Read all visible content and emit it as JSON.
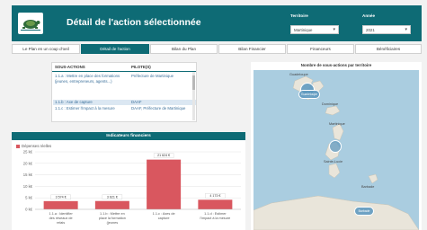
{
  "header": {
    "title": "Détail de l'action sélectionnée",
    "filters": [
      {
        "label": "Territoire",
        "value": "Martinique"
      },
      {
        "label": "Année",
        "value": "2021"
      }
    ]
  },
  "tabs": [
    {
      "label": "Le Plan en un coup d'oeil",
      "active": false
    },
    {
      "label": "Détail de l'action",
      "active": true
    },
    {
      "label": "Bilan du Plan",
      "active": false
    },
    {
      "label": "Bilan Financier",
      "active": false
    },
    {
      "label": "Financeurs",
      "active": false
    },
    {
      "label": "Bénéficiaires",
      "active": false
    }
  ],
  "actions_table": {
    "columns": [
      "Sous-actions",
      "Pilote(s)"
    ],
    "rows": [
      {
        "action": "1.1.a : Mettre en place des formations (jeunes, entrepreneurs, agents...)",
        "pilot": "Préfecture de Martinique",
        "selected": false
      },
      {
        "action": "1.1.b : Axe de capture",
        "pilot": "DAAF",
        "selected": true
      },
      {
        "action": "1.1.c : Estimer l'impact à la mesure",
        "pilot": "DAAF, Préfecture de Martinique",
        "selected": false
      }
    ]
  },
  "financial_chart": {
    "title": "Indicateurs financiers",
    "legend": "Dépenses réelles",
    "colors": {
      "bar": "#d9575f",
      "header": "#0e6b75"
    }
  },
  "chart_data": {
    "type": "bar",
    "title": "Indicateurs financiers",
    "categories": [
      "1.1.a : Identifier des réseaux de relais",
      "1.1.b : Mettre en place la formation (jeunes entrepreneurs)",
      "1.1.c : Axes de capture",
      "1.1.d : Estimer l'impact à la mesure"
    ],
    "series": [
      {
        "name": "Dépenses réelles",
        "values": [
          3574,
          3621,
          21624,
          4173
        ]
      }
    ],
    "data_labels": [
      "3 574 €",
      "3 621 €",
      "21 624 €",
      "4 173 €"
    ],
    "ylim": [
      0,
      25000
    ],
    "yticks": [
      0,
      5000,
      10000,
      15000,
      20000,
      25000
    ],
    "ytick_labels": [
      "0 k€",
      "5 k€",
      "10 k€",
      "15 k€",
      "20 k€",
      "25 k€"
    ]
  },
  "map": {
    "title": "Nombre de sous-actions par territoire",
    "labels": [
      "Guadeloupe",
      "Dominique",
      "Martinique",
      "Sainte-Lucie",
      "Barbade"
    ],
    "bubbles": [
      "Guadeloupe",
      "Martinique",
      "Barbade"
    ],
    "colors": {
      "sea": "#aacde0",
      "land": "#e9e5da",
      "bubble": "#609ac0"
    }
  }
}
